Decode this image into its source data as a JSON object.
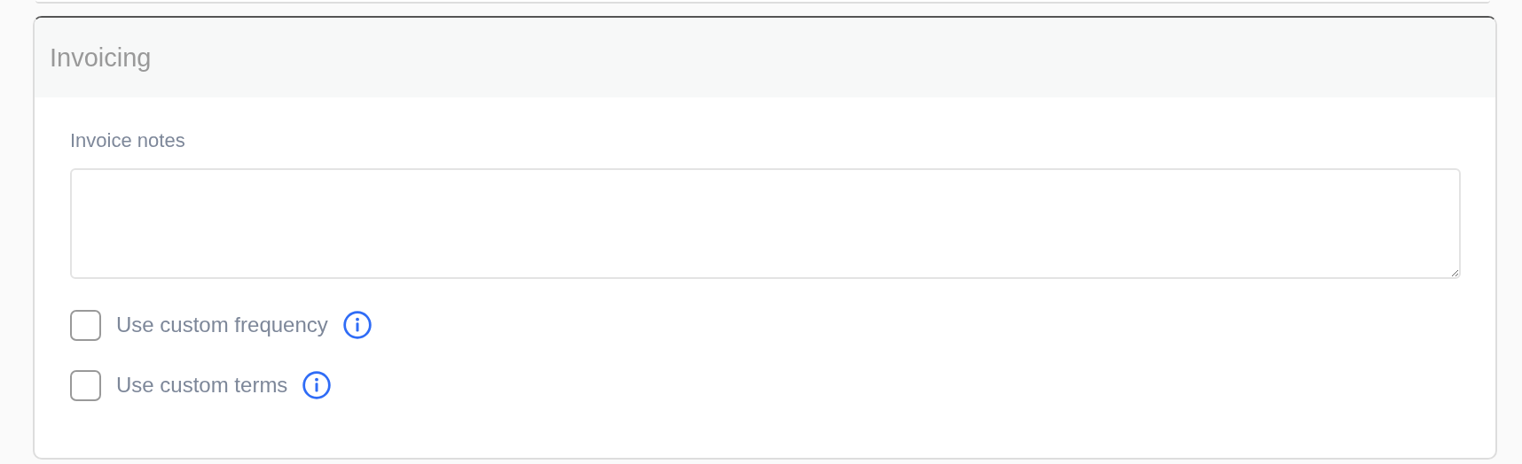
{
  "section": {
    "title": "Invoicing"
  },
  "invoice_notes": {
    "label": "Invoice notes"
  },
  "options": [
    {
      "label": "Use custom frequency",
      "checked": false
    },
    {
      "label": "Use custom terms",
      "checked": false
    }
  ]
}
